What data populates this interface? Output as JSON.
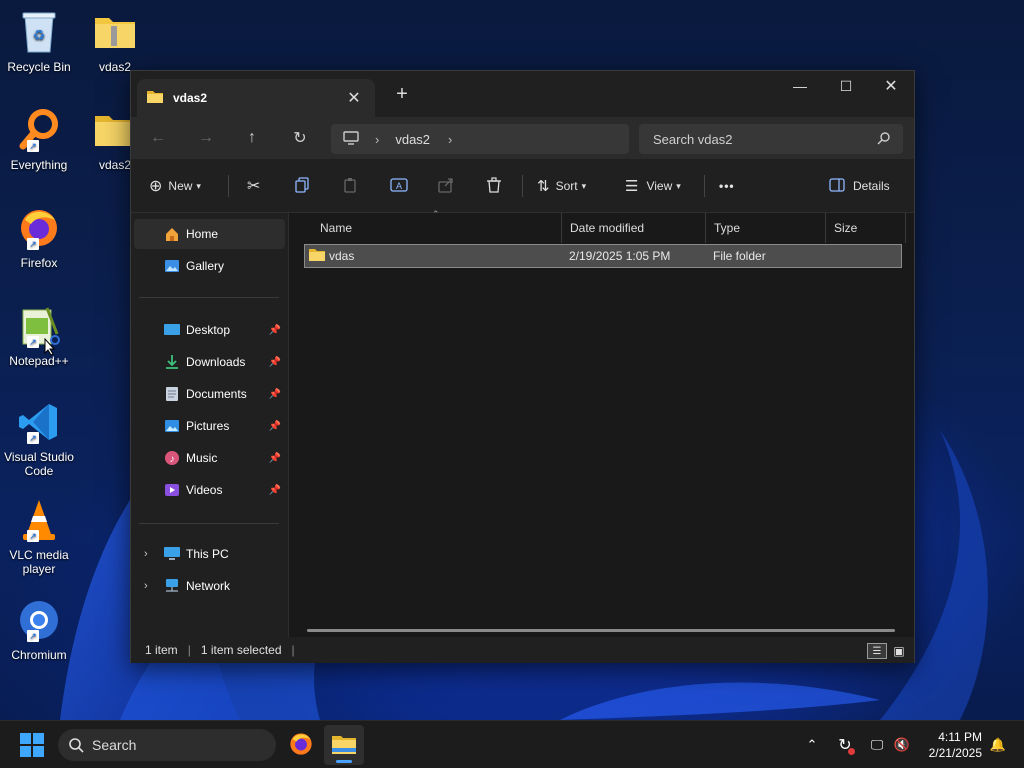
{
  "desktop": {
    "icons": [
      {
        "label": "Recycle Bin"
      },
      {
        "label": "vdas2"
      },
      {
        "label": "Everything"
      },
      {
        "label": "vdas2"
      },
      {
        "label": "Firefox"
      },
      {
        "label": "Notepad++"
      },
      {
        "label": "Visual Studio Code"
      },
      {
        "label": "VLC media player"
      },
      {
        "label": "Chromium"
      }
    ]
  },
  "window": {
    "tab_title": "vdas2",
    "new_tab": "+",
    "address": {
      "root_icon": "this-pc-icon",
      "crumb": "vdas2"
    },
    "search_placeholder": "Search vdas2",
    "commands": {
      "new": "New",
      "sort": "Sort",
      "view": "View",
      "more": "•••",
      "details": "Details"
    },
    "nav": {
      "home": "Home",
      "gallery": "Gallery",
      "desktop": "Desktop",
      "downloads": "Downloads",
      "documents": "Documents",
      "pictures": "Pictures",
      "music": "Music",
      "videos": "Videos",
      "this_pc": "This PC",
      "network": "Network"
    },
    "columns": [
      "Name",
      "Date modified",
      "Type",
      "Size"
    ],
    "files": [
      {
        "name": "vdas",
        "date": "2/19/2025 1:05 PM",
        "type": "File folder",
        "size": ""
      }
    ],
    "status": {
      "count": "1 item",
      "selected": "1 item selected"
    }
  },
  "taskbar": {
    "search": "Search",
    "time": "4:11 PM",
    "date": "2/21/2025"
  },
  "colors": {
    "folder": "#f3c63f",
    "accent": "#4aa3ff",
    "selection": "#4d4d4d"
  }
}
